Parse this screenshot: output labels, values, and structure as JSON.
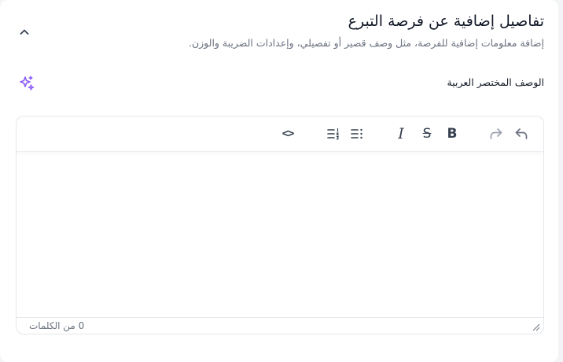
{
  "section": {
    "title": "تفاصيل إضافية عن فرصة التبرع",
    "subtitle": "إضافة معلومات إضافية للفرصة، مثل وصف قصير أو تفصيلي، وإعدادات الضريبة والوزن."
  },
  "field": {
    "label": "الوصف المختصر العربية"
  },
  "editor": {
    "toolbar": {
      "undo_icon": "undo-icon",
      "redo_icon": "redo-icon",
      "bold_glyph": "B",
      "strike_glyph": "S",
      "italic_glyph": "I",
      "bullet_list_icon": "bullet-list-icon",
      "ordered_list_icon": "ordered-list-icon",
      "code_glyph": "<>"
    },
    "content": "",
    "word_count": "0 من الكلمات"
  },
  "colors": {
    "accent": "#8b5cf6",
    "text_primary": "#111827",
    "text_muted": "#6b7280",
    "border": "#e5e7eb"
  }
}
